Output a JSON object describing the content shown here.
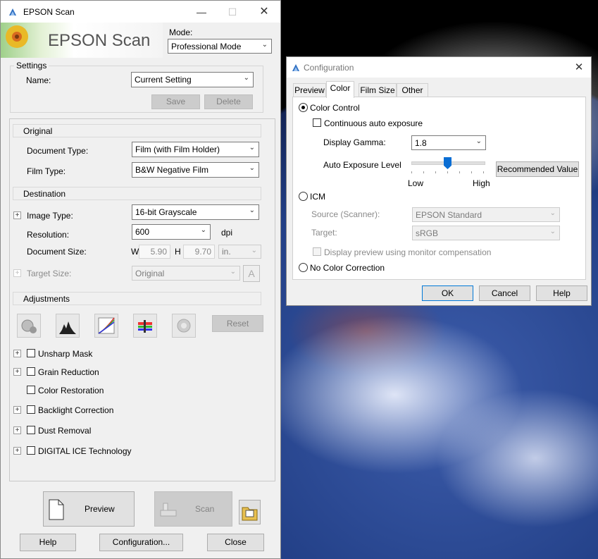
{
  "epson": {
    "title": "EPSON Scan",
    "logo_text": "EPSON Scan",
    "mode_label": "Mode:",
    "mode_value": "Professional Mode",
    "settings": {
      "group_label": "Settings",
      "name_label": "Name:",
      "name_value": "Current Setting",
      "save": "Save",
      "delete": "Delete"
    },
    "original": {
      "header": "Original",
      "doc_type_label": "Document Type:",
      "doc_type_value": "Film (with Film Holder)",
      "film_type_label": "Film Type:",
      "film_type_value": "B&W Negative Film"
    },
    "destination": {
      "header": "Destination",
      "image_type_label": "Image Type:",
      "image_type_value": "16-bit Grayscale",
      "resolution_label": "Resolution:",
      "resolution_value": "600",
      "dpi": "dpi",
      "doc_size_label": "Document Size:",
      "w_label": "W",
      "w_value": "5.90",
      "h_label": "H",
      "h_value": "9.70",
      "unit": "in.",
      "target_size_label": "Target Size:",
      "target_size_value": "Original"
    },
    "adjustments": {
      "header": "Adjustments",
      "reset": "Reset",
      "items": [
        "Unsharp Mask",
        "Grain Reduction",
        "Color Restoration",
        "Backlight Correction",
        "Dust Removal",
        "DIGITAL ICE Technology"
      ]
    },
    "preview": "Preview",
    "scan": "Scan",
    "help": "Help",
    "configuration": "Configuration...",
    "close": "Close"
  },
  "config": {
    "title": "Configuration",
    "tabs": [
      "Preview",
      "Color",
      "Film Size",
      "Other"
    ],
    "color_control": "Color Control",
    "continuous_auto_exposure": "Continuous auto exposure",
    "display_gamma_label": "Display Gamma:",
    "display_gamma_value": "1.8",
    "auto_exposure_label": "Auto Exposure Level",
    "slider_low": "Low",
    "slider_high": "High",
    "slider_level": 0.5,
    "recommended_value": "Recommended Value",
    "icm": "ICM",
    "source_label": "Source (Scanner):",
    "source_value": "EPSON Standard",
    "target_label": "Target:",
    "target_value": "sRGB",
    "display_preview_monitor": "Display preview using monitor compensation",
    "no_color_correction": "No Color Correction",
    "ok": "OK",
    "cancel": "Cancel",
    "help": "Help"
  }
}
